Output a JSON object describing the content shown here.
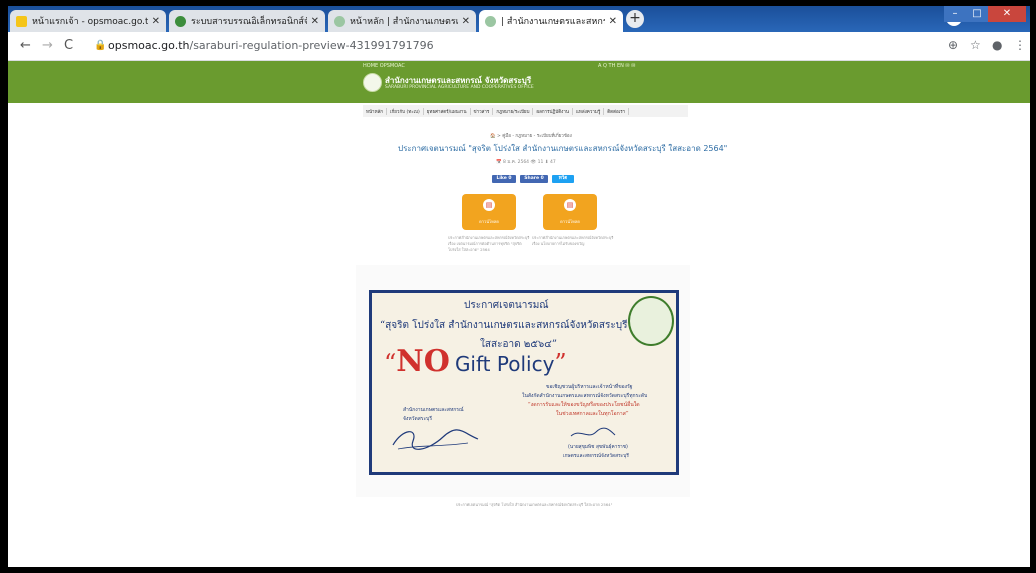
{
  "browser": {
    "tabs": [
      {
        "title": "หน้าแรกเจ้า - opsmoac.go.th - Sm",
        "favicon_color": "#f5c518"
      },
      {
        "title": "ระบบสารบรรณอิเล็กทรอนิกส์จังหวัดส",
        "favicon_color": "#3c8d3c"
      },
      {
        "title": "หน้าหลัก | สำนักงานเกษตรและสหกรณ์",
        "favicon_color": "#9bc6a2"
      },
      {
        "title": "| สำนักงานเกษตรและสหกรณ์ จังหวัดส",
        "favicon_color": "#9bc6a2"
      }
    ],
    "new_tab_label": "+",
    "url_domain": "opsmoac.go.th",
    "url_path": "/saraburi-regulation-preview-431991791796"
  },
  "site": {
    "top_links_left": "HOME   OPSMOAC",
    "top_links_right": "A  Q  TH  EN  ✉  ✉",
    "org_name": "สำนักงานเกษตรและสหกรณ์ จังหวัดสระบุรี",
    "org_sub": "SARABURI PROVINCIAL AGRICULTURE AND COOPERATIVES OFFICE",
    "menu": [
      "หน้าหลัก",
      "เกี่ยวกับ (ทะเบ)",
      "ยุทธศาสตร์/แผนงาน",
      "ข่าวสาร",
      "กฎหมาย/ระเบียบ",
      "ผลการปฏิบัติงาน",
      "แหล่งความรู้",
      "ติดต่อเรา"
    ]
  },
  "article": {
    "breadcrumb": "🏠  >  คู่มือ - กฎหมาย - ระเบียบที่เกี่ยวข้อง",
    "title": "ประกาศเจตนารมณ์ \"สุจริต โปร่งใส สำนักงานเกษตรและสหกรณ์จังหวัดสระบุรี ใสสะอาด 2564\"",
    "meta": "📅 8 ม.ค. 2564   👁 11   ⬇ 47",
    "like_label": "Like 0",
    "share_label": "Share 0",
    "tweet_label": "ทวีต",
    "downloads": [
      {
        "label": "ดาวน์โหลด",
        "text": "ประกาศสำนักงานเกษตรและสหกรณ์จังหวัดสระบุรี เรื่อง เจตนารมณ์การต่อต้านการทุจริต \"สุจริต โปร่งใส ใสสะอาด\" 2564"
      },
      {
        "label": "ดาวน์โหลด",
        "text": "ประกาศสำนักงานเกษตรและสหกรณ์จังหวัดสระบุรี เรื่อง นโยบายการไม่รับของขวัญ"
      }
    ],
    "caption": "ประกาศเจตนารมณ์ \"สุจริต โปร่งใส สำนักงานเกษตรและสหกรณ์จังหวัดสระบุรี ใสสะอาด 2564\""
  },
  "poster": {
    "line1": "ประกาศเจตนารมณ์",
    "line2": "“สุจริต โปร่งใส สำนักงานเกษตรและสหกรณ์จังหวัดสระบุรี",
    "line3": "ใสสะอาด ๒๕๖๔”",
    "no_quote_open": "“",
    "no_text": "NO",
    "gift_text": "Gift Policy",
    "no_quote_close": "”",
    "invite1": "ขอเชิญชวนผู้บริหารและเจ้าหน้าที่ของรัฐ",
    "invite2": "ในสังกัดสำนักงานเกษตรและสหกรณ์จังหวัดสระบุรีทุกระดับ",
    "invite3": "“งดการรับและให้ของขวัญหรือของประโยชน์อื่นใด",
    "invite4": "ในช่วงเทศกาลและในทุกโอกาส”",
    "left_org1": "สำนักงานเกษตรและสหกรณ์",
    "left_org2": "จังหวัดสระบุรี",
    "signer_name": "(นายสุขุมพิช สุขพันธ์ุคาราช)",
    "signer_title": "เกษตรและสหกรณ์จังหวัดสระบุรี"
  },
  "colors": {
    "green_header": "#6a9b2f",
    "download_orange": "#f2a41f",
    "poster_navy": "#1f3a7a",
    "poster_red": "#d0312d"
  }
}
